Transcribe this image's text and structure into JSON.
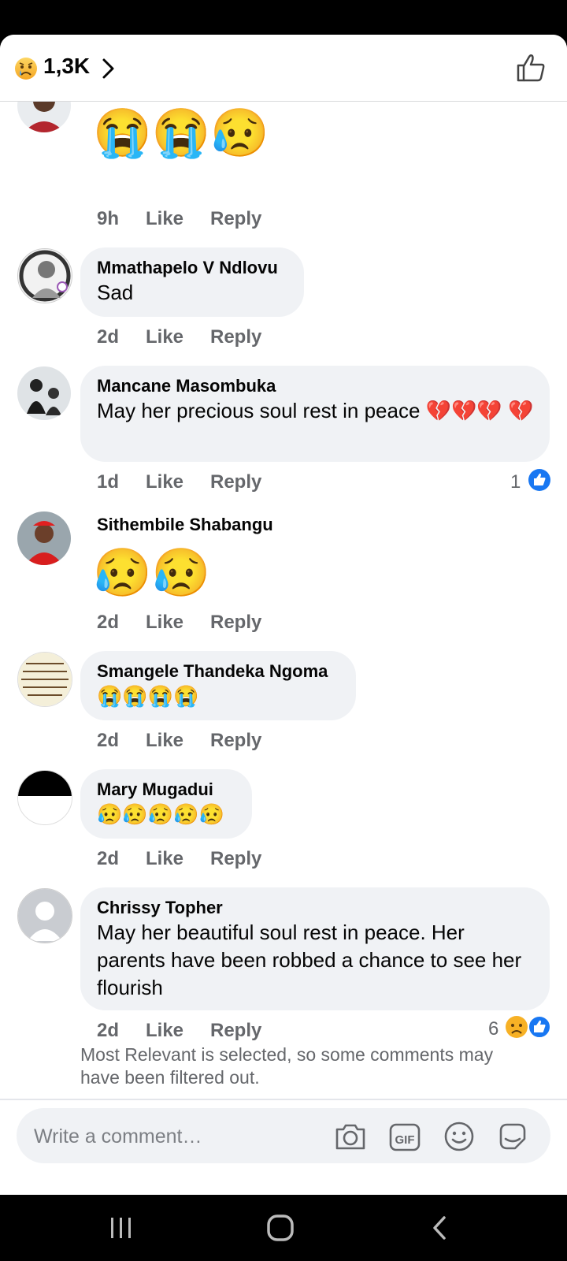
{
  "header": {
    "reaction_count": "1,3K",
    "reaction_icon": "sad-face-emoji",
    "like_icon": "thumbs-up-outline-icon"
  },
  "comments": [
    {
      "name": "",
      "text": "😭😭😥",
      "time": "9h",
      "like": "Like",
      "reply": "Reply"
    },
    {
      "name": "Mmathapelo V Ndlovu",
      "text": "Sad",
      "time": "2d",
      "like": "Like",
      "reply": "Reply"
    },
    {
      "name": "Mancane Masombuka",
      "text": "May her precious soul rest in peace 💔💔💔 💔",
      "time": "1d",
      "like": "Like",
      "reply": "Reply",
      "reactions": "1"
    },
    {
      "name": "Sithembile Shabangu",
      "text": "😥😥",
      "time": "2d",
      "like": "Like",
      "reply": "Reply"
    },
    {
      "name": "Smangele Thandeka Ngoma",
      "text": "😭😭😭😭",
      "time": "2d",
      "like": "Like",
      "reply": "Reply"
    },
    {
      "name": "Mary Mugadui",
      "text": "😥😥😥😥😥",
      "time": "2d",
      "like": "Like",
      "reply": "Reply"
    },
    {
      "name": "Chrissy Topher",
      "text": "May her beautiful soul rest in peace. Her parents have been robbed a chance to see her flourish",
      "time": "2d",
      "like": "Like",
      "reply": "Reply",
      "reactions": "6"
    }
  ],
  "filter_note": "Most Relevant is selected, so some comments may have been filtered out.",
  "composer": {
    "placeholder": "Write a comment…"
  },
  "colors": {
    "like_blue": "#1877f2",
    "bubble_bg": "#f0f2f5",
    "meta_grey": "#65676b",
    "emoji_yellow": "#f7b125"
  }
}
